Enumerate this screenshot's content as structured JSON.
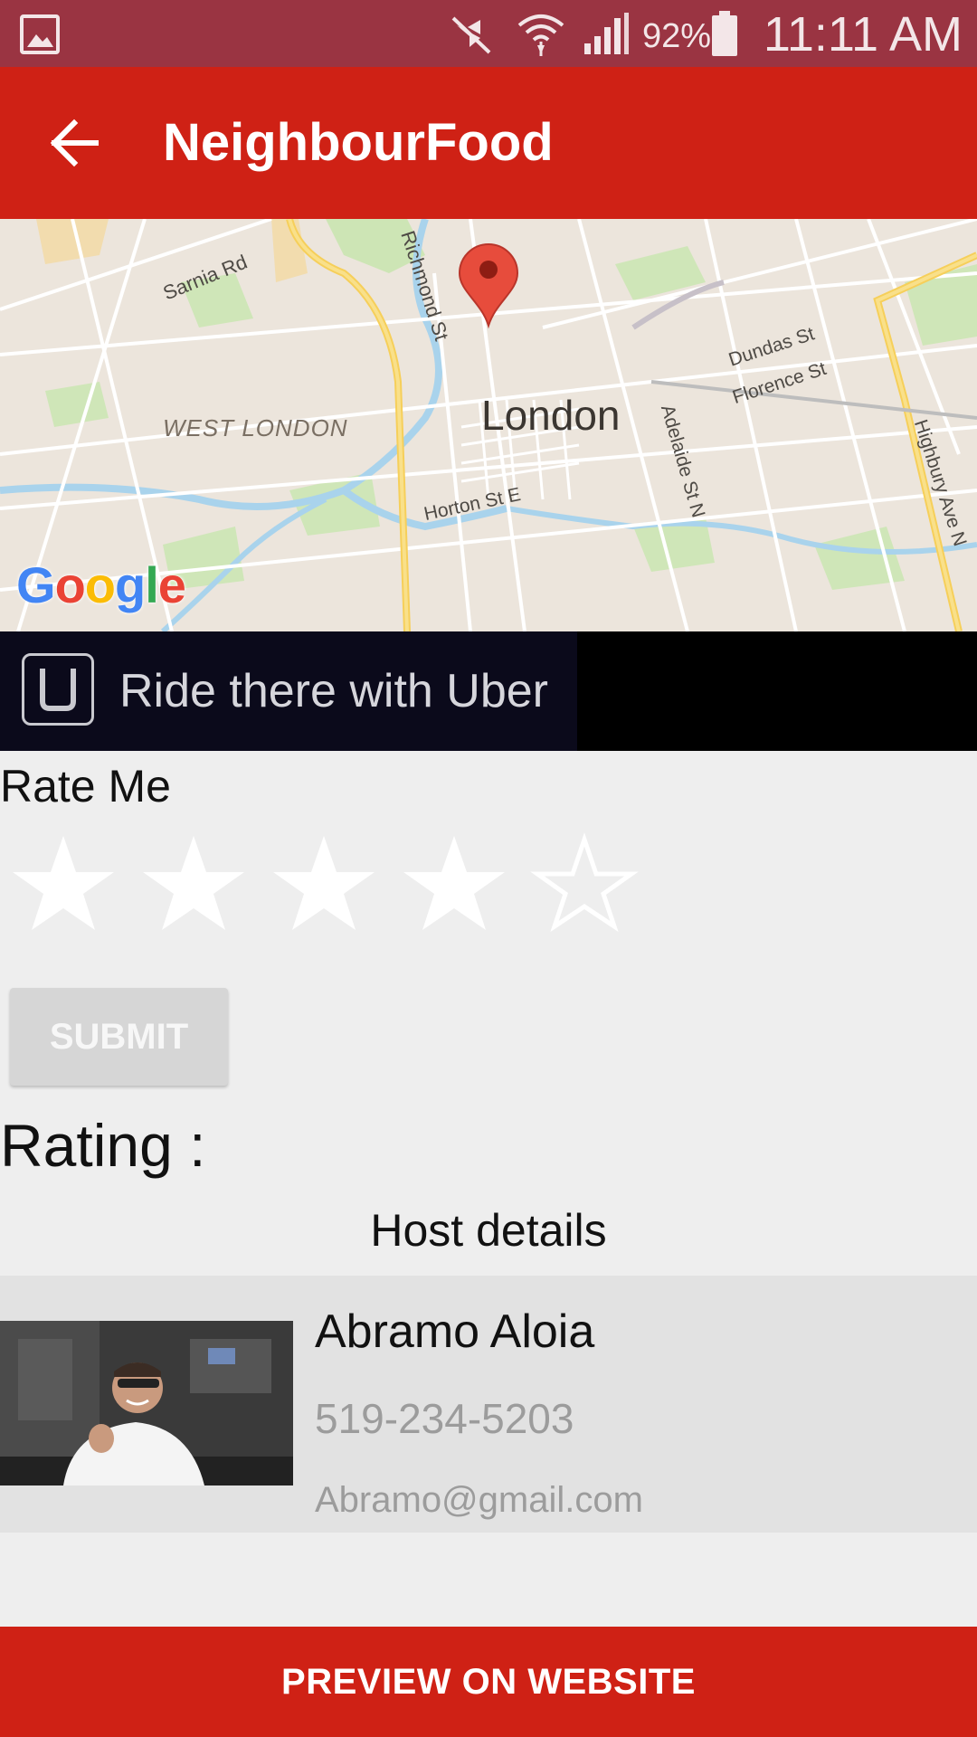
{
  "status_bar": {
    "battery_percent": "92%",
    "time": "11:11 AM",
    "icons": [
      "gallery-icon",
      "mute-icon",
      "wifi-icon",
      "signal-icon",
      "battery-icon"
    ]
  },
  "app_bar": {
    "title": "NeighbourFood",
    "back_icon": "arrow-left-icon"
  },
  "map": {
    "labels": {
      "sarnia": "Sarnia Rd",
      "richmond": "Richmond St",
      "west_london": "WEST LONDON",
      "london": "London",
      "dundas": "Dundas St",
      "florence": "Florence St",
      "adelaide": "Adelaide St N",
      "horton": "Horton St E",
      "highbury": "Highbury Ave N"
    },
    "logo": "Google"
  },
  "uber": {
    "label": "Ride there with Uber"
  },
  "rating": {
    "rate_label": "Rate Me",
    "stars_filled": 4,
    "stars_total": 5,
    "submit_label": "SUBMIT",
    "rating_label": "Rating :"
  },
  "host": {
    "heading": "Host details",
    "name": "Abramo Aloia",
    "phone": "519-234-5203",
    "email": "Abramo@gmail.com"
  },
  "footer": {
    "preview_label": "PREVIEW ON WEBSITE"
  },
  "colors": {
    "status_bar": "#9a3442",
    "accent": "#cf2115",
    "uber_bg": "#0b0a1b"
  }
}
